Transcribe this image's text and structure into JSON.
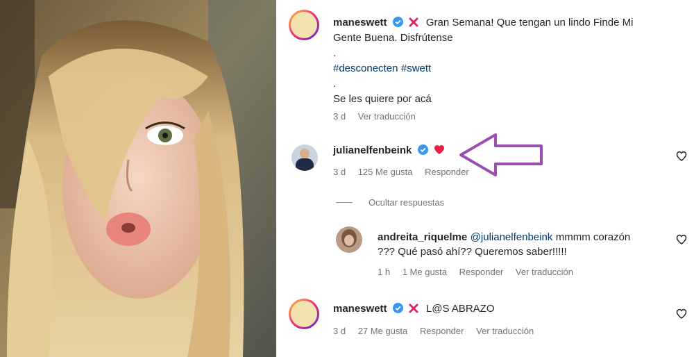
{
  "post": {
    "username": "maneswett",
    "caption_line1": "Gran Semana! Que tengan un lindo Finde Mi",
    "caption_line2": "Gente Buena. Disfrútense",
    "dot1": ".",
    "hashtag1": "#desconecten",
    "hashtag2": "#swett",
    "dot2": ".",
    "caption_line3": "Se les quiere por acá",
    "time": "3 d",
    "translate": "Ver traducción"
  },
  "comment1": {
    "username": "julianelfenbeink",
    "time": "3 d",
    "likes": "125 Me gusta",
    "reply": "Responder",
    "hide_replies": "Ocultar respuestas"
  },
  "reply1": {
    "username": "andreita_riquelme",
    "mention": "@julianelfenbeink",
    "text1": "mmmm corazón",
    "text2": "??? Qué pasó ahí?? Queremos saber!!!!!",
    "time": "1 h",
    "likes": "1 Me gusta",
    "reply": "Responder",
    "translate": "Ver traducción"
  },
  "comment2": {
    "username": "maneswett",
    "text": "L@S ABRAZO",
    "time": "3 d",
    "likes": "27 Me gusta",
    "reply": "Responder",
    "translate": "Ver traducción"
  },
  "colors": {
    "verified": "#3897f0",
    "red_x": "#e0245e",
    "heart": "#ed1d45",
    "arrow": "#9b4fb0"
  },
  "icons": [
    "verified-icon",
    "red-x-icon",
    "heart-icon",
    "like-heart-icon",
    "purple-arrow"
  ]
}
